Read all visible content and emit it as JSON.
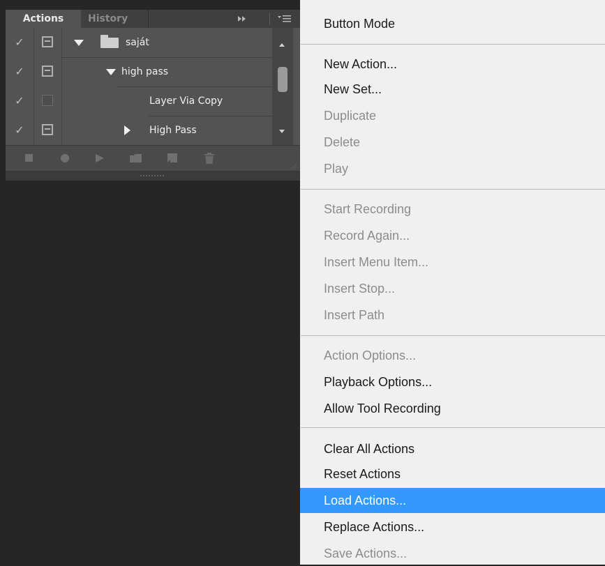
{
  "actions_panel": {
    "tabs": [
      {
        "label": "Actions",
        "active": true
      },
      {
        "label": "History",
        "active": false
      }
    ],
    "header_controls": {
      "collapse_icon": "double-chevron-right-icon",
      "menu_icon": "panel-menu-icon"
    },
    "rows": [
      {
        "checked": true,
        "dialog": "on",
        "expanded": true,
        "kind": "set",
        "label": "saját"
      },
      {
        "checked": true,
        "dialog": "on",
        "expanded": true,
        "kind": "action",
        "label": "high pass"
      },
      {
        "checked": true,
        "dialog": "off",
        "kind": "command",
        "label": "Layer Via Copy"
      },
      {
        "checked": true,
        "dialog": "on",
        "expanded": false,
        "kind": "command",
        "label": "High Pass"
      }
    ],
    "toolbar_icons": [
      "stop-icon",
      "record-icon",
      "play-icon",
      "new-set-icon",
      "new-action-icon",
      "delete-icon"
    ]
  },
  "flyout_menu": {
    "sections": [
      [
        {
          "label": "Button Mode",
          "enabled": true
        }
      ],
      [
        {
          "label": "New Action...",
          "enabled": true
        },
        {
          "label": "New Set...",
          "enabled": true
        },
        {
          "label": "Duplicate",
          "enabled": false
        },
        {
          "label": "Delete",
          "enabled": false
        },
        {
          "label": "Play",
          "enabled": false
        }
      ],
      [
        {
          "label": "Start Recording",
          "enabled": false
        },
        {
          "label": "Record Again...",
          "enabled": false
        },
        {
          "label": "Insert Menu Item...",
          "enabled": false
        },
        {
          "label": "Insert Stop...",
          "enabled": false
        },
        {
          "label": "Insert Path",
          "enabled": false
        }
      ],
      [
        {
          "label": "Action Options...",
          "enabled": false
        },
        {
          "label": "Playback Options...",
          "enabled": true
        },
        {
          "label": "Allow Tool Recording",
          "enabled": true
        }
      ],
      [
        {
          "label": "Clear All Actions",
          "enabled": true
        },
        {
          "label": "Reset Actions",
          "enabled": true
        },
        {
          "label": "Load Actions...",
          "enabled": true,
          "highlighted": true
        },
        {
          "label": "Replace Actions...",
          "enabled": true
        },
        {
          "label": "Save Actions...",
          "enabled": false
        }
      ]
    ],
    "highlight_color": "#3399ff"
  }
}
